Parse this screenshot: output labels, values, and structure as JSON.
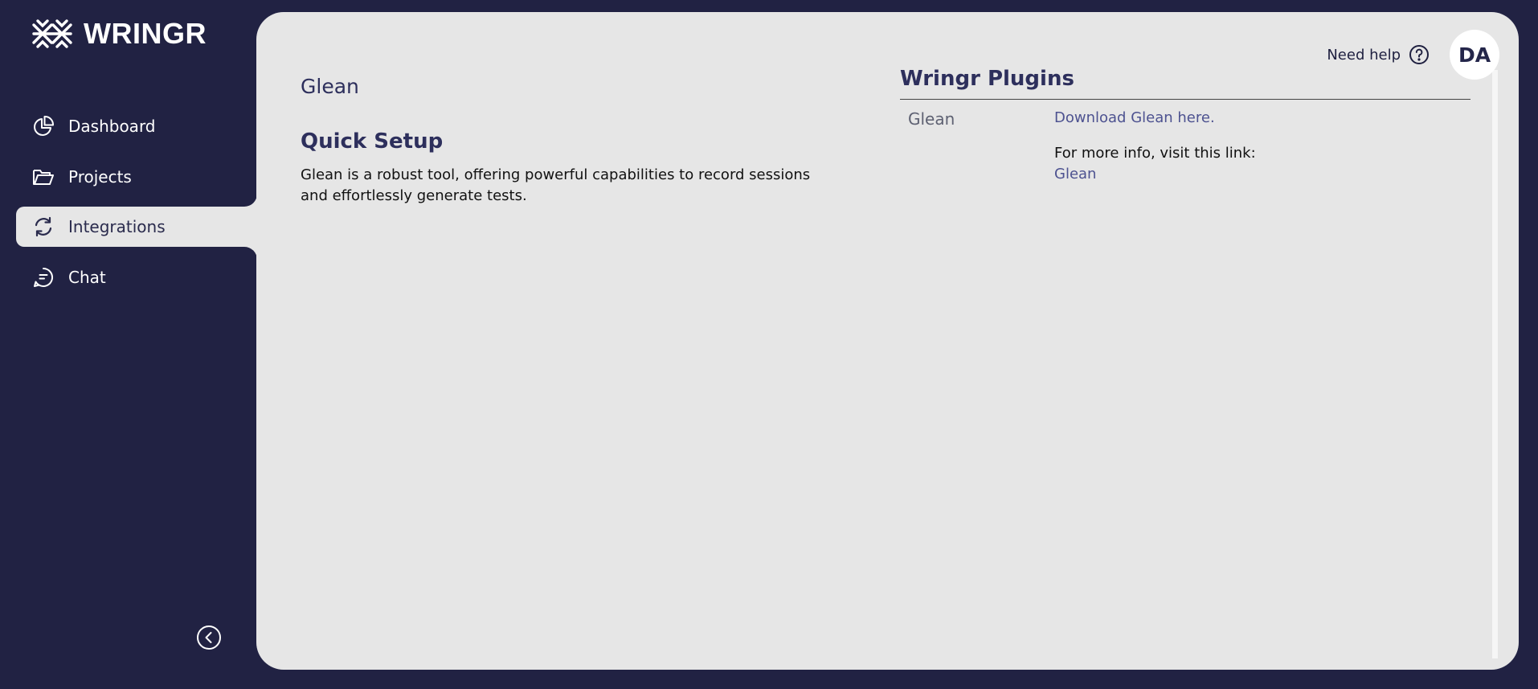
{
  "app": {
    "name": "WRINGR"
  },
  "sidebar": {
    "items": [
      {
        "label": "Dashboard",
        "icon": "pie-chart-icon",
        "active": false
      },
      {
        "label": "Projects",
        "icon": "folder-icon",
        "active": false
      },
      {
        "label": "Integrations",
        "icon": "refresh-icon",
        "active": true
      },
      {
        "label": "Chat",
        "icon": "chat-bubble-icon",
        "active": false
      }
    ],
    "collapse_icon": "chevron-left-circle-icon"
  },
  "header": {
    "help_label": "Need help",
    "avatar_initials": "DA"
  },
  "main": {
    "title": "Glean",
    "section_title": "Quick Setup",
    "description": "Glean is a robust tool, offering powerful capabilities to record sessions and effortlessly generate tests."
  },
  "plugins": {
    "title": "Wringr Plugins",
    "row": {
      "name": "Glean",
      "download_link": "Download Glean here.",
      "more_info_label": "For more info, visit this link:",
      "info_link": "Glean"
    }
  },
  "colors": {
    "sidebar_bg": "#212243",
    "panel_bg": "#e6e6e6",
    "heading": "#2d2f5c",
    "link": "#4d5290"
  }
}
